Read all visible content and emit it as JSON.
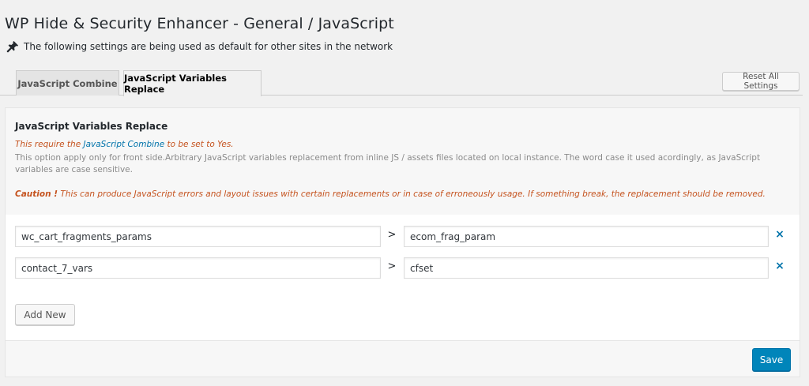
{
  "page": {
    "title": "WP Hide & Security Enhancer - General / JavaScript",
    "notice": "The following settings are being used as default for other sites in the network",
    "notice_icon": "pin-icon"
  },
  "tabs": [
    {
      "label": "JavaScript Combine",
      "active": false
    },
    {
      "label": "JavaScript Variables Replace",
      "active": true
    }
  ],
  "toolbar": {
    "reset_label": "Reset All Settings"
  },
  "section": {
    "title": "JavaScript Variables Replace",
    "require_prefix": "This require the ",
    "require_link": "JavaScript Combine",
    "require_suffix": " to be set to Yes.",
    "description": "This option apply only for front side.Arbitrary JavaScript variables replacement from inline JS / assets files located on local instance. The word case it used acordingly, as JavaScript variables are case sensitive.",
    "caution_label": "Caution !",
    "caution_text": " This can produce JavaScript errors and layout issues with certain replacements or in case of erroneously usage. If something break, the replacement should be removed."
  },
  "replacements": [
    {
      "from": "wc_cart_fragments_params",
      "arrow": ">",
      "to": "ecom_frag_param",
      "remove": "×"
    },
    {
      "from": "contact_7_vars",
      "arrow": ">",
      "to": "cfset",
      "remove": "×"
    }
  ],
  "actions": {
    "add_label": "Add New",
    "save_label": "Save"
  },
  "colors": {
    "accent": "#0085ba",
    "link": "#0073aa",
    "warning": "#c5531f",
    "background": "#f1f1f1"
  }
}
